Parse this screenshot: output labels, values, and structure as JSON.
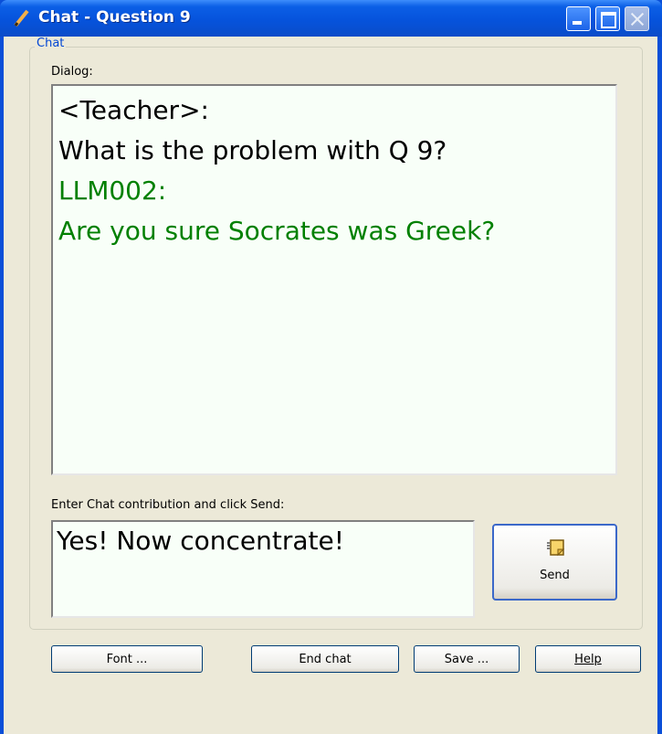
{
  "window": {
    "title": "Chat - Question 9"
  },
  "chat": {
    "group_label": "Chat",
    "dialog_label": "Dialog:",
    "messages": [
      {
        "text": "<Teacher>:",
        "color": "#000000"
      },
      {
        "text": "What is the problem with Q 9?",
        "color": "#000000"
      },
      {
        "text": "LLM002:",
        "color": "#008000"
      },
      {
        "text": "Are you sure Socrates was Greek?",
        "color": "#008000"
      }
    ],
    "input_label": "Enter Chat contribution and click Send:",
    "input_value": "Yes! Now concentrate!",
    "send_label": "Send"
  },
  "buttons": {
    "font": "Font ...",
    "end_chat": "End chat",
    "save": "Save ...",
    "help": "Help"
  },
  "icons": {
    "title": "pencil-icon",
    "send": "note-icon"
  },
  "colors": {
    "titlebar": "#0653dc",
    "client_bg": "#ece9d8",
    "dialog_bg": "#f8fff8",
    "group_label": "#0046d5",
    "student_message": "#008000"
  }
}
